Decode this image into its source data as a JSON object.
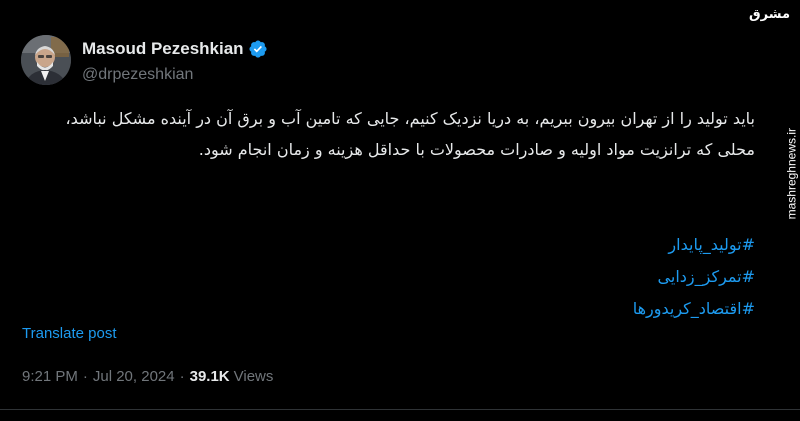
{
  "author": {
    "display_name": "Masoud Pezeshkian",
    "handle": "@drpezeshkian",
    "verified": true
  },
  "tweet": {
    "text": "باید تولید را از تهران بیرون ببریم، به دریا نزدیک کنیم، جایی که تامین آب و برق آن در آینده مشکل نباشد، محلی که ترانزیت مواد اولیه و صادرات محصولات با حداقل هزینه و زمان انجام شود.",
    "hashtags": [
      "#تولید_پایدار",
      "#تمرکز_زدایی",
      "#اقتصاد_کریدورها"
    ]
  },
  "translate_label": "Translate post",
  "meta": {
    "time": "9:21 PM",
    "separator": "·",
    "date": "Jul 20, 2024",
    "views_count": "39.1K",
    "views_label": "Views"
  },
  "watermark": {
    "logo_text": "مشرق",
    "site": "mashreghnews.ir"
  },
  "colors": {
    "background": "#000000",
    "text_primary": "#e7e9ea",
    "text_secondary": "#71767b",
    "link": "#1d9bf0",
    "verified_badge": "#1d9bf0",
    "divider": "#2f3336"
  },
  "icons": {
    "verified": "verified-badge-icon",
    "avatar": "profile-avatar"
  }
}
